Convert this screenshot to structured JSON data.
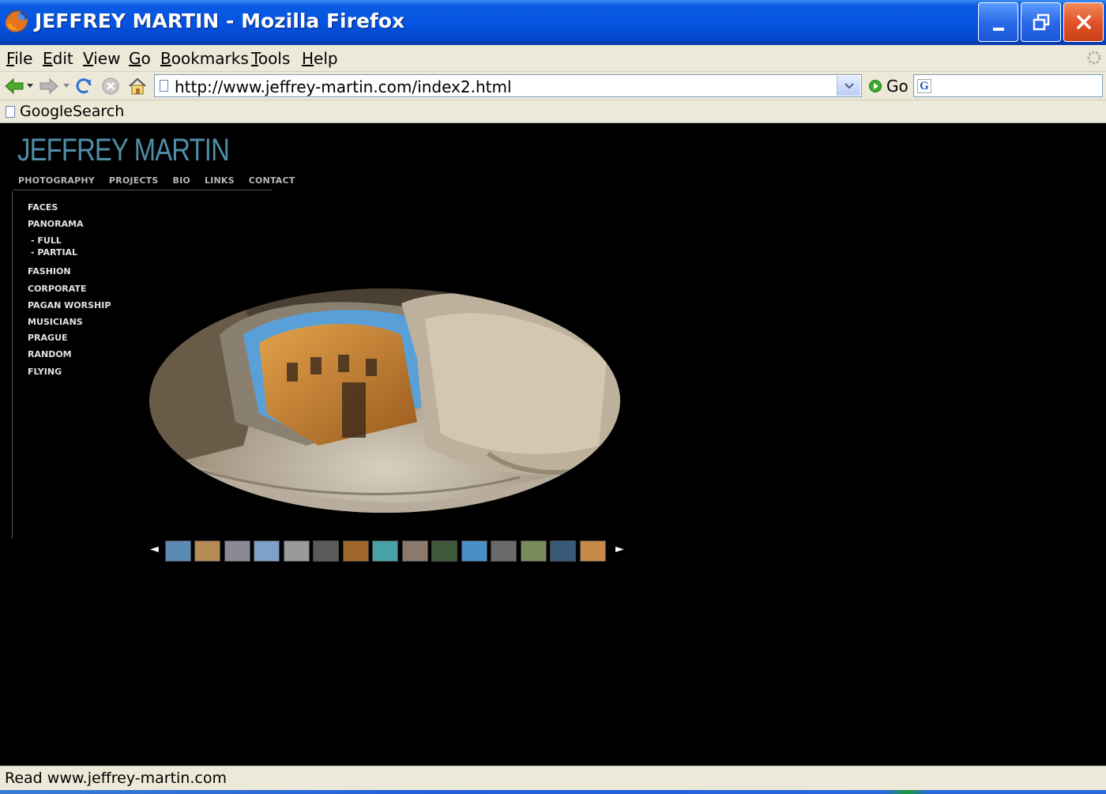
{
  "window": {
    "title": "JEFFREY MARTIN - Mozilla Firefox",
    "controls": [
      "minimize",
      "maximize",
      "close"
    ]
  },
  "menubar": {
    "items": [
      {
        "label": "File",
        "accel": "F",
        "rest": "ile"
      },
      {
        "label": "Edit",
        "accel": "E",
        "rest": "dit"
      },
      {
        "label": "View",
        "accel": "V",
        "rest": "iew"
      },
      {
        "label": "Go",
        "accel": "G",
        "rest": "o"
      },
      {
        "label": "Bookmarks",
        "accel": "B",
        "rest": "ookmarks"
      },
      {
        "label": "Tools",
        "accel": "T",
        "rest": "ools"
      },
      {
        "label": "Help",
        "accel": "H",
        "rest": "elp"
      }
    ]
  },
  "toolbar": {
    "url": "http://www.jeffrey-martin.com/index2.html",
    "go_label": "Go",
    "search_value": ""
  },
  "bookmarks": {
    "items": [
      {
        "label": "GoogleSearch"
      }
    ]
  },
  "site": {
    "title": "JEFFREY MARTIN",
    "topnav": [
      "PHOTOGRAPHY",
      "PROJECTS",
      "BIO",
      "LINKS",
      "CONTACT"
    ],
    "sidemenu": [
      {
        "label": "FACES"
      },
      {
        "label": "PANORAMA"
      },
      {
        "label": "- FULL"
      },
      {
        "label": "- PARTIAL"
      },
      {
        "label": "FASHION"
      },
      {
        "label": "CORPORATE"
      },
      {
        "label": "PAGAN WORSHIP"
      },
      {
        "label": "MUSICIANS"
      },
      {
        "label": "PRAGUE"
      },
      {
        "label": "RANDOM"
      },
      {
        "label": "FLYING"
      }
    ],
    "strip": {
      "prev": "◄",
      "next": "►",
      "thumb_colors": [
        "#5b8bb5",
        "#b58a55",
        "#8a8a95",
        "#7fa0c8",
        "#9a9a9a",
        "#5a5a5a",
        "#a0662a",
        "#4aa0a8",
        "#8a7a6a",
        "#3f5a3a",
        "#4a90c8",
        "#6a6a6a",
        "#7a8a5a",
        "#3a5a7a",
        "#c88a4a"
      ]
    }
  },
  "status": {
    "text": "Read www.jeffrey-martin.com"
  }
}
